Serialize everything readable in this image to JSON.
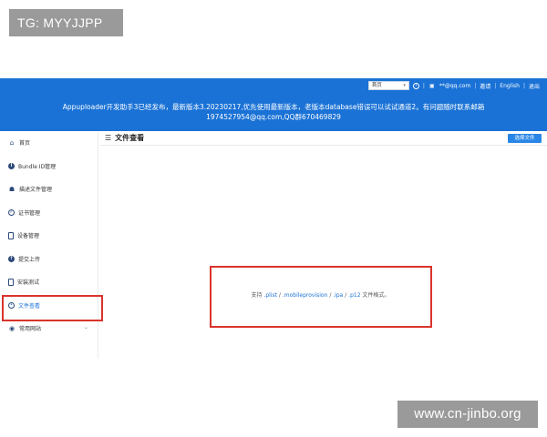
{
  "tag_badge": "TG: MYYJJPP",
  "watermark": "www.cn-jinbo.org",
  "topbar": {
    "language_select": "首页",
    "help_icon": "question-circle-icon",
    "user_email": "**@qq.com",
    "share_label": "邀请",
    "english_label": "English",
    "logout_label": "退出",
    "banner_line1": "Appuploader开发助手3已经发布，最新版本3.20230217,优先使用最新版本，老版本database错误可以试试通道2。有问题随时联系邮箱",
    "banner_line2": "1974527954@qq.com,QQ群670469829"
  },
  "sidebar": {
    "items": [
      {
        "label": "首页",
        "icon": "home-icon"
      },
      {
        "label": "Bundle ID管理",
        "icon": "info-icon"
      },
      {
        "label": "描述文件管理",
        "icon": "users-icon"
      },
      {
        "label": "证书管理",
        "icon": "check-circle-icon"
      },
      {
        "label": "设备管理",
        "icon": "phone-icon"
      },
      {
        "label": "提交上传",
        "icon": "upload-icon"
      },
      {
        "label": "安装测试",
        "icon": "file-icon"
      },
      {
        "label": "文件查看",
        "icon": "eye-icon"
      },
      {
        "label": "常用网站",
        "icon": "location-icon"
      }
    ]
  },
  "main": {
    "title": "文件查看",
    "select_file_button": "选择文件",
    "support_prefix": "支持 ",
    "ext_plist": ".plist",
    "sep1": " / ",
    "ext_mobileprovision": ".mobileprovision",
    "sep2": " / ",
    "ext_ipa": ".ipa",
    "sep3": " / ",
    "ext_p12": ".p12",
    "support_suffix": " 文件格式。"
  },
  "colors": {
    "topbar": "#1a72d6",
    "highlight": "#d9342b",
    "badge": "#9a9a9a"
  }
}
